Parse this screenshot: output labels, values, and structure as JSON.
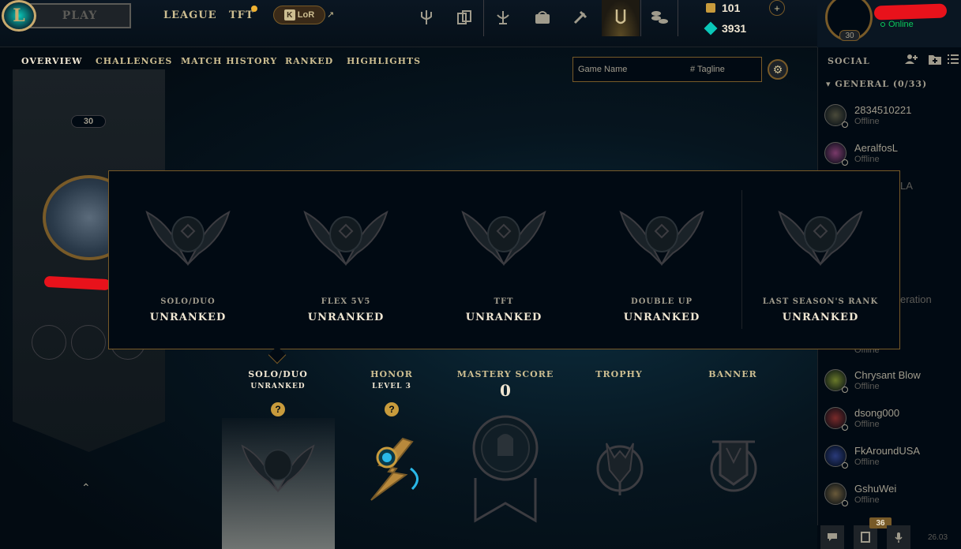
{
  "topbar": {
    "play_label": "PLAY",
    "nav": [
      "LEAGUE",
      "TFT"
    ],
    "lor_label": "LoR",
    "lor_icon": "K",
    "external_icon": "↗",
    "icons": [
      "trident-icon",
      "collection-icon",
      "rewards-icon",
      "loot-icon",
      "crafting-icon",
      "clash-icon",
      "store-icon"
    ],
    "rp": "101",
    "be": "3931",
    "plus": "+"
  },
  "profile": {
    "level": "30",
    "status": "Online"
  },
  "subnav": {
    "tabs": [
      "OVERVIEW",
      "CHALLENGES",
      "MATCH HISTORY",
      "RANKED",
      "HIGHLIGHTS"
    ],
    "active_tab": "OVERVIEW",
    "search_name_placeholder": "Game Name",
    "search_tag_placeholder": "# Tagline",
    "settings_icon": "⚙"
  },
  "banner": {
    "level": "30",
    "chevron": "⌃"
  },
  "ranked_tooltip": [
    {
      "queue": "SOLO/DUO",
      "tier": "UNRANKED"
    },
    {
      "queue": "FLEX 5V5",
      "tier": "UNRANKED"
    },
    {
      "queue": "TFT",
      "tier": "UNRANKED"
    },
    {
      "queue": "DOUBLE UP",
      "tier": "UNRANKED"
    },
    {
      "queue": "LAST SEASON'S RANK",
      "tier": "UNRANKED"
    }
  ],
  "stats": {
    "solo_title": "SOLO/DUO",
    "solo_sub": "UNRANKED",
    "honor_title": "HONOR",
    "honor_sub": "LEVEL 3",
    "mastery_title": "MASTERY SCORE",
    "mastery_score": "0",
    "trophy_title": "TROPHY",
    "banner_title": "BANNER",
    "help": "?"
  },
  "social": {
    "title": "SOCIAL",
    "group": "GENERAL (0/33)",
    "friends": [
      {
        "name": "2834510221",
        "status": "Offline",
        "color": "#4a4a3a"
      },
      {
        "name": "AeralfosL",
        "status": "Offline",
        "color": "#7a3a6a"
      },
      {
        "name": "Chrysant Blow",
        "status": "Offline",
        "color": "#6a7a2a"
      },
      {
        "name": "dsong000",
        "status": "Offline",
        "color": "#7a2a2a"
      },
      {
        "name": "FkAroundUSA",
        "status": "Offline",
        "color": "#2a3a7a"
      },
      {
        "name": "GshuWei",
        "status": "Offline",
        "color": "#6a5a3a"
      }
    ],
    "partial": [
      "LA",
      "eration",
      "Offline"
    ],
    "notif_count": "36",
    "version": "26.03"
  }
}
